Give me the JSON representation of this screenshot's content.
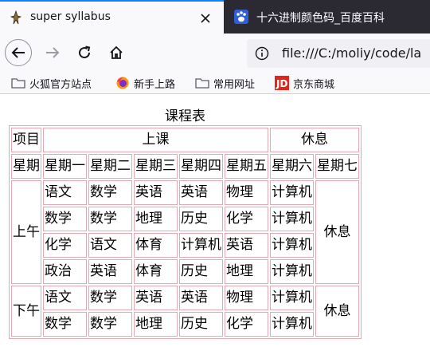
{
  "browser": {
    "active_tab": {
      "title": "super syllabus"
    },
    "inactive_tab": {
      "title": "十六进制颜色码_百度百科"
    },
    "url": "file:///C:/moliy/code/la"
  },
  "bookmarks": [
    {
      "label": "火狐官方站点",
      "icon": "folder-icon"
    },
    {
      "label": "新手上路",
      "icon": "firefox-icon"
    },
    {
      "label": "常用网址",
      "icon": "folder-icon"
    },
    {
      "label": "京东商城",
      "icon": "jd-icon"
    }
  ],
  "colors": {
    "tab_strip": "#2b2a33",
    "accent": "#0a84ff",
    "table_border": "#e8a7b3"
  },
  "table": {
    "caption": "课程表",
    "header1": {
      "item": "项目",
      "class": "上课",
      "rest": "休息"
    },
    "days": [
      "星期",
      "星期一",
      "星期二",
      "星期三",
      "星期四",
      "星期五",
      "星期六",
      "星期七"
    ],
    "morning": {
      "label": "上午",
      "rest": "休息",
      "rows": [
        [
          "语文",
          "数学",
          "英语",
          "英语",
          "物理",
          "计算机"
        ],
        [
          "数学",
          "数学",
          "地理",
          "历史",
          "化学",
          "计算机"
        ],
        [
          "化学",
          "语文",
          "体育",
          "计算机",
          "英语",
          "计算机"
        ],
        [
          "政治",
          "英语",
          "体育",
          "历史",
          "地理",
          "计算机"
        ]
      ]
    },
    "afternoon": {
      "label": "下午",
      "rest": "休息",
      "rows": [
        [
          "语文",
          "数学",
          "英语",
          "英语",
          "物理",
          "计算机"
        ],
        [
          "数学",
          "数学",
          "地理",
          "历史",
          "化学",
          "计算机"
        ]
      ]
    }
  }
}
